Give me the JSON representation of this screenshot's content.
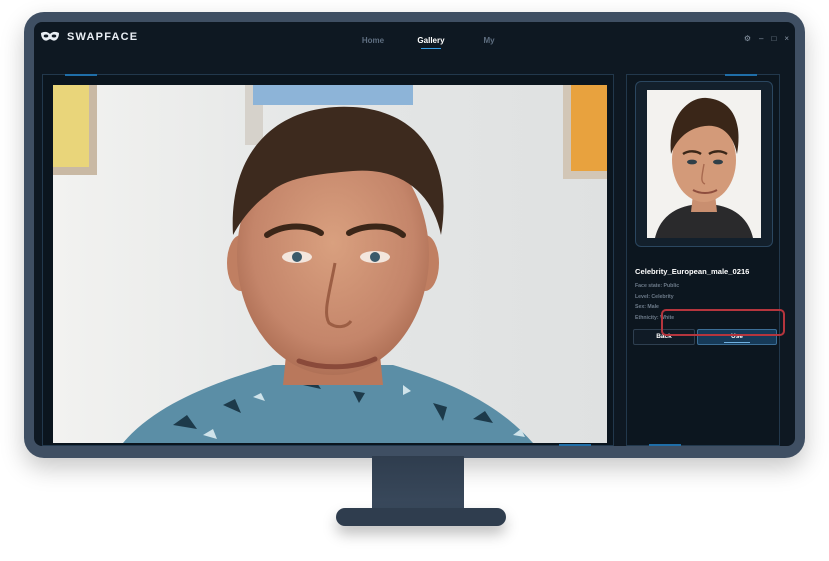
{
  "app": {
    "title": "SWAPFACE",
    "icon": "mask-icon",
    "brand_color": "#1f6ea8"
  },
  "nav": {
    "items": [
      {
        "label": "Home",
        "active": false
      },
      {
        "label": "Gallery",
        "active": true
      },
      {
        "label": "My",
        "active": false
      }
    ]
  },
  "window_controls": {
    "settings": "⚙",
    "minimize": "–",
    "maximize": "□",
    "close": "×"
  },
  "profile": {
    "name": "Celebrity_European_male_0216",
    "face_state": "Face state: Public",
    "level": "Level: Celebrity",
    "sex": "Sex: Male",
    "ethnicity": "Ethnicity: White"
  },
  "buttons": {
    "back": "Back",
    "use": "Use"
  },
  "highlight_color": "#b5353d"
}
